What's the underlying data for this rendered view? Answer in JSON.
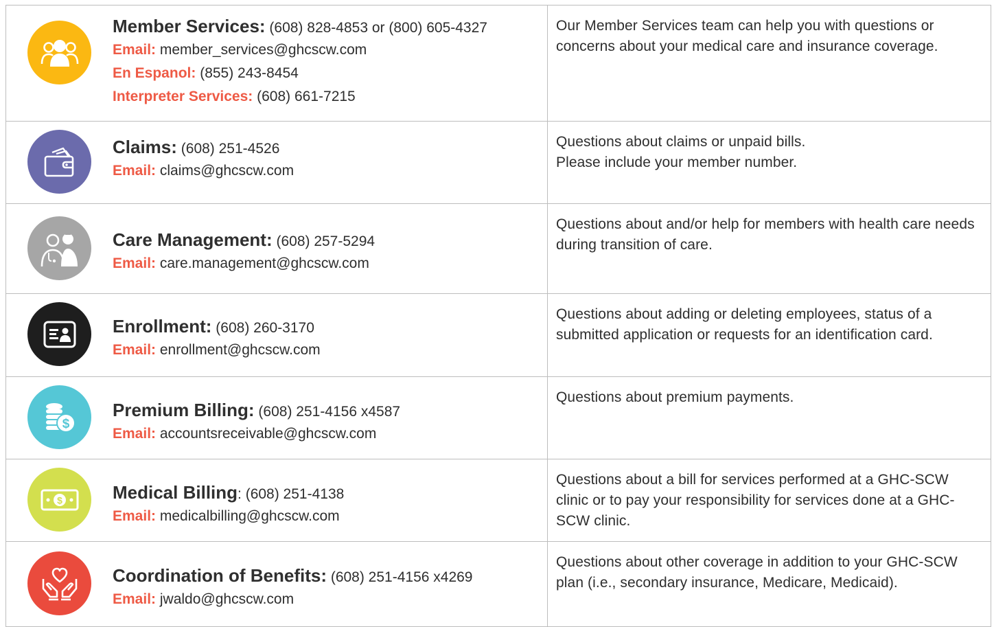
{
  "rows": [
    {
      "name": "Member Services:",
      "phone": "(608) 828-4853 or (800) 605-4327",
      "details": [
        {
          "label": "Email:",
          "value": "member_services@ghcscw.com"
        },
        {
          "label": "En Espanol:",
          "value": "(855) 243-8454"
        },
        {
          "label": "Interpreter Services:",
          "value": "(608) 661-7215"
        }
      ],
      "description": "Our Member Services team can help you with questions or concerns about your medical care and insurance coverage.",
      "icon": "people-group-icon",
      "color": "#fbb812"
    },
    {
      "name": "Claims:",
      "phone": "(608) 251-4526",
      "details": [
        {
          "label": "Email:",
          "value": "claims@ghcscw.com"
        }
      ],
      "description": "Questions about claims or unpaid bills.\nPlease include your member number.",
      "icon": "wallet-icon",
      "color": "#6b6bac"
    },
    {
      "name": "Care Management:",
      "phone": "(608) 257-5294",
      "details": [
        {
          "label": "Email:",
          "value": "care.management@ghcscw.com"
        }
      ],
      "description": "Questions about and/or help for members with health care needs during transition of care.",
      "icon": "doctor-nurse-icon",
      "color": "#a6a6a6"
    },
    {
      "name": "Enrollment:",
      "phone": "(608) 260-3170",
      "details": [
        {
          "label": "Email:",
          "value": "enrollment@ghcscw.com"
        }
      ],
      "description": "Questions about adding or deleting employees, status of a submitted application or requests for an identification card.",
      "icon": "id-card-icon",
      "color": "#1e1e1e"
    },
    {
      "name": "Premium Billing:",
      "phone": "(608) 251-4156 x4587",
      "details": [
        {
          "label": "Email:",
          "value": "accountsreceivable@ghcscw.com"
        }
      ],
      "description": "Questions about premium payments.",
      "icon": "coins-icon",
      "color": "#55c7d6"
    },
    {
      "name": "Medical Billing",
      "phone": ": (608) 251-4138",
      "details": [
        {
          "label": "Email:",
          "value": "medicalbilling@ghcscw.com"
        }
      ],
      "description": "Questions about a bill for services performed at a GHC-SCW clinic or to pay your responsibility for services done at a GHC-SCW clinic.",
      "icon": "banknote-icon",
      "color": "#d3df4e"
    },
    {
      "name": "Coordination of Benefits:",
      "phone": "(608) 251-4156 x4269",
      "details": [
        {
          "label": "Email:",
          "value": "jwaldo@ghcscw.com"
        }
      ],
      "description": "Questions about other coverage in addition to your GHC-SCW plan (i.e., secondary insurance, Medicare, Medicaid).",
      "icon": "heart-hands-icon",
      "color": "#ea4b3d"
    }
  ]
}
